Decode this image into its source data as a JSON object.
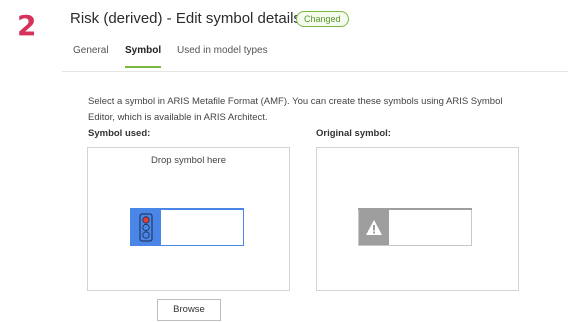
{
  "step_number": "2",
  "header": {
    "title": "Risk (derived) - Edit symbol details",
    "badge": "Changed"
  },
  "tabs": [
    {
      "label": "General",
      "active": false
    },
    {
      "label": "Symbol",
      "active": true
    },
    {
      "label": "Used in model types",
      "active": false
    }
  ],
  "description": "Select a symbol in ARIS Metafile Format (AMF). You can create these symbols using ARIS Symbol Editor, which is available in ARIS Architect.",
  "symbol_used": {
    "label": "Symbol used:",
    "drop_hint": "Drop symbol here",
    "icon": "traffic-light-icon"
  },
  "original_symbol": {
    "label": "Original symbol:",
    "icon": "warning-icon"
  },
  "browse_label": "Browse",
  "colors": {
    "accent_green": "#7ab83b",
    "step_number": "#d6335c",
    "symbol_blue": "#4a86e8",
    "symbol_gray": "#9e9e9e"
  }
}
